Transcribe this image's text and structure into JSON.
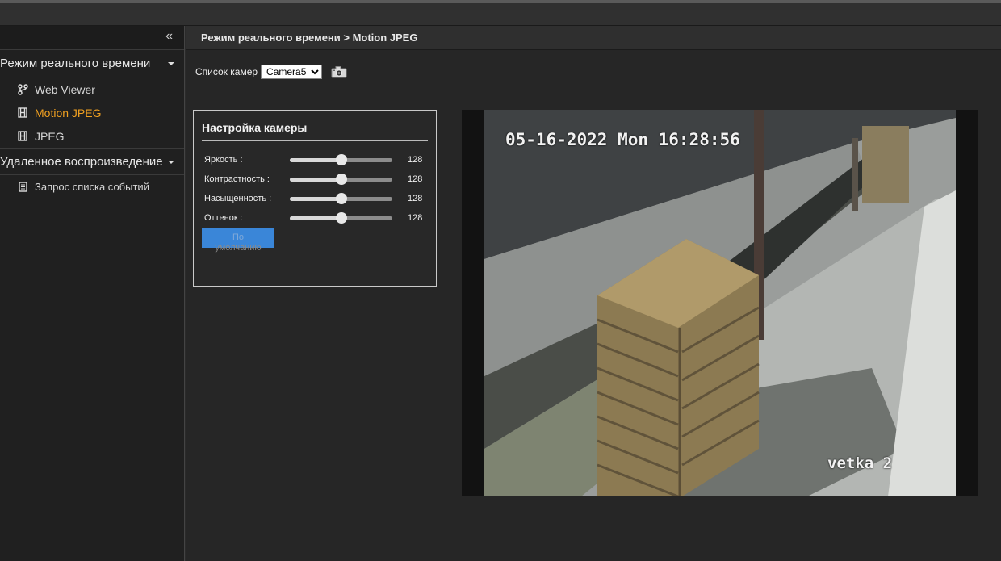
{
  "sidebar": {
    "collapse_icon": "double-chevron-left-icon",
    "groups": [
      {
        "label": "Режим реального времени",
        "items": [
          {
            "label": "Web Viewer",
            "icon": "branch-icon",
            "active": false
          },
          {
            "label": "Motion JPEG",
            "icon": "film-icon",
            "active": true
          },
          {
            "label": "JPEG",
            "icon": "film-icon",
            "active": false
          }
        ]
      },
      {
        "label": "Удаленное воспроизведение",
        "items": [
          {
            "label": "Запрос списка событий",
            "icon": "document-icon",
            "active": false
          }
        ]
      }
    ]
  },
  "breadcrumb": "Режим реального времени > Motion JPEG",
  "camera_list": {
    "label": "Список камер",
    "selected": "Camera5",
    "snapshot_icon": "camera-icon"
  },
  "settings": {
    "title": "Настройка камеры",
    "sliders": [
      {
        "label": "Яркость :",
        "value": 128,
        "max": 255
      },
      {
        "label": "Контрастность :",
        "value": 128,
        "max": 255
      },
      {
        "label": "Насыщенность :",
        "value": 128,
        "max": 255
      },
      {
        "label": "Оттенок :",
        "value": 128,
        "max": 255
      }
    ],
    "default_button": {
      "line1": "По",
      "line2": "умолчанию"
    }
  },
  "video": {
    "timestamp": "05-16-2022 Mon 16:28:56",
    "caption": "vetka 2"
  },
  "colors": {
    "active_item": "#f0a020",
    "button": "#3a86d8"
  }
}
